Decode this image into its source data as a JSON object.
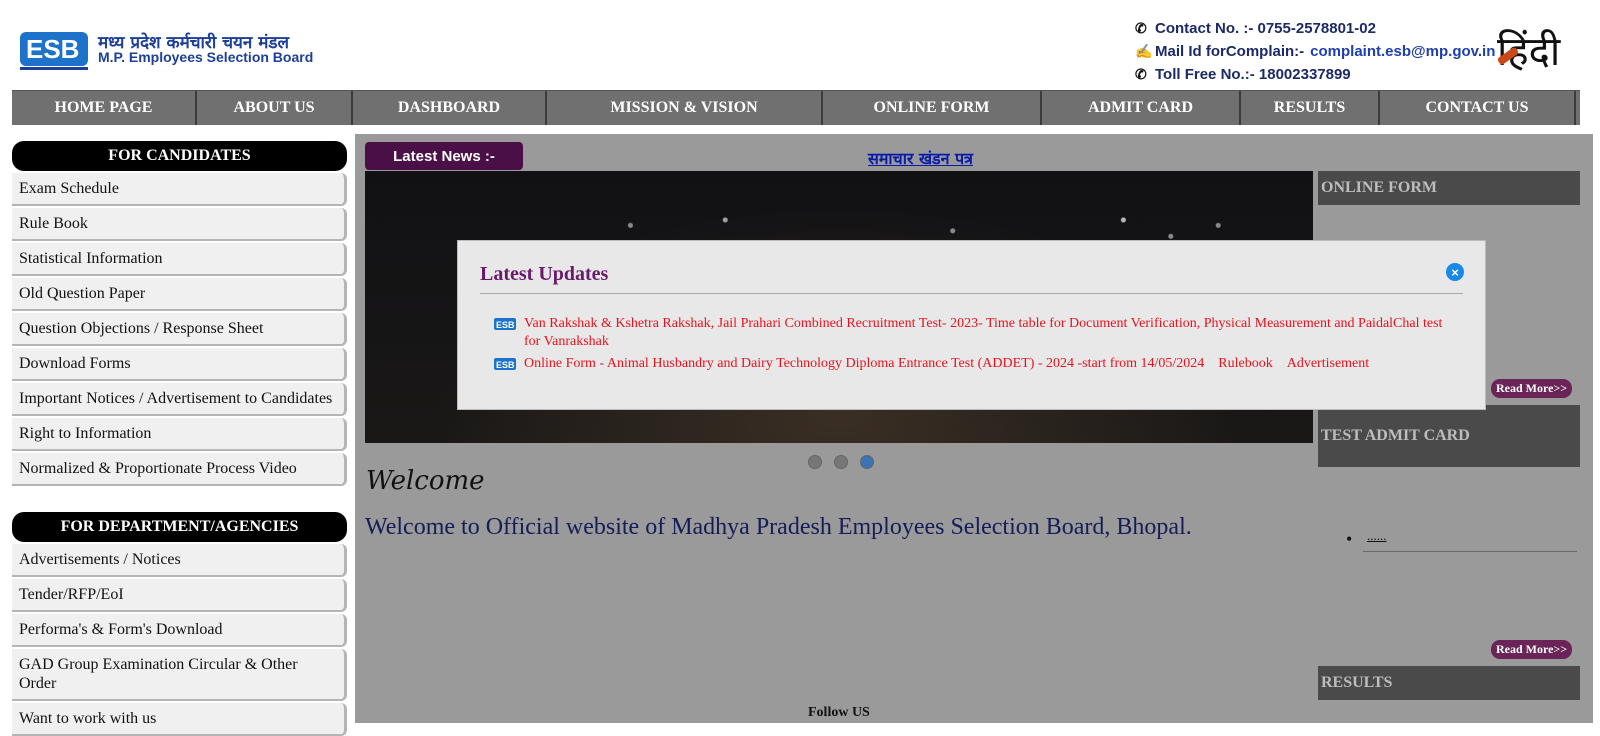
{
  "header": {
    "logo_hindi": "मध्य प्रदेश कर्मचारी चयन मंडल",
    "logo_english": "M.P. Employees Selection Board",
    "contact_no": "Contact No. :- 0755-2578801-02",
    "mail_label": "Mail Id forComplain:-",
    "mail_value": "complaint.esb@mp.gov.in",
    "toll_free": "Toll Free No.:- 18002337899",
    "language_toggle": "हिंदी"
  },
  "nav": [
    {
      "label": "HOME PAGE"
    },
    {
      "label": "ABOUT US"
    },
    {
      "label": "DASHBOARD"
    },
    {
      "label": "MISSION & VISION"
    },
    {
      "label": "ONLINE FORM"
    },
    {
      "label": "ADMIT CARD"
    },
    {
      "label": "RESULTS"
    },
    {
      "label": "CONTACT US"
    }
  ],
  "sidebar_candidates": {
    "title": "FOR CANDIDATES",
    "items": [
      "Exam Schedule",
      "Rule Book",
      "Statistical Information",
      "Old Question Paper",
      "Question Objections / Response Sheet",
      "Download Forms",
      "Important Notices / Advertisement to Candidates",
      "Right to Information",
      "Normalized & Proportionate Process Video"
    ]
  },
  "sidebar_departments": {
    "title": "FOR DEPARTMENT/AGENCIES",
    "items": [
      "Advertisements / Notices",
      "Tender/RFP/EoI",
      "Performa's & Form's Download",
      "GAD Group Examination Circular & Other Order",
      "Want to work with us"
    ]
  },
  "main": {
    "latest_news_label": "Latest News :-",
    "news_link": "समाचार खंडन पत्र",
    "welcome_script": "Welcome",
    "welcome_text": "Welcome to Official website of Madhya Pradesh Employees Selection Board, Bhopal.",
    "follow_us": "Follow US",
    "slider_dots": 3,
    "slider_active": 3
  },
  "right": {
    "online_form": "ONLINE FORM",
    "test_admit_card": "TEST ADMIT CARD",
    "results": "RESULTS",
    "read_more": "Read More>>",
    "admit_bullet": "......"
  },
  "modal": {
    "title": "Latest Updates",
    "close_icon": "close-icon",
    "updates": [
      {
        "text": "Van Rakshak & Kshetra Rakshak, Jail Prahari Combined Recruitment Test- 2023- Time table for Document Verification, Physical Measurement and PaidalChal test for Vanrakshak"
      },
      {
        "text": "Online Form - Animal Husbandry and Dairy Technology Diploma Entrance Test (ADDET) - 2024 -start from 14/05/2024",
        "link1": "Rulebook",
        "link2": "Advertisement"
      }
    ]
  },
  "colors": {
    "nav_bg": "#707070",
    "accent_purple": "#4a0f47",
    "update_red": "#e8121e",
    "brand_blue": "#1d3f9a"
  }
}
